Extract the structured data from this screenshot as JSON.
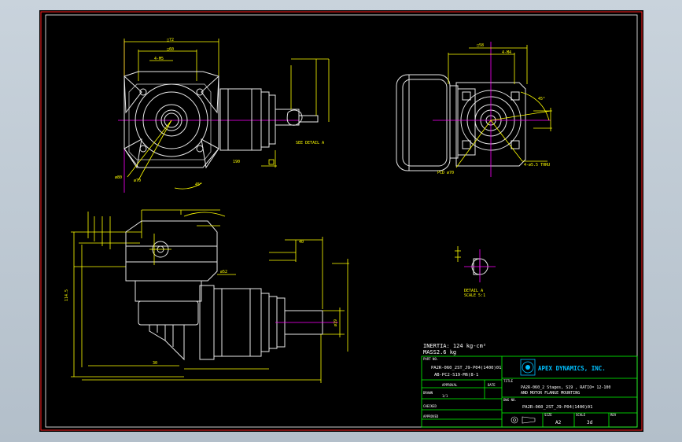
{
  "drawing": {
    "notes": {
      "inertia": "INERTIA: 124 kg-cm²",
      "mass": "MASS2.6 kg"
    },
    "title_block": {
      "part_no_label": "PART NO.",
      "part_no_line1": "PA2R-060_2ST_J9-P04(1400)01",
      "part_no_line2": "AB-PC2-S19-M6(8-1",
      "approval_label": "APPROVAL",
      "date_label": "DATE",
      "drawn_label": "DRAWN",
      "drawn_value": "1/1",
      "checked_label": "CHECKED",
      "approved_label": "APPROVED",
      "company": "APEX DYNAMICS, INC.",
      "title_label": "TITLE",
      "title_line1": "PA2R-060_2 Stages, S19 , RATIO= 12-100",
      "title_line2": "AND MOTOR FLANGE MOUNTING",
      "dwg_no_label": "DWG NO.",
      "dwg_no_value": "PA2R-060_2ST_J9-P04(1400)01",
      "size_label": "SIZE",
      "size_value": "A2",
      "scale_label": "SCALE",
      "scale_value": "3d",
      "rev_label": "REV"
    },
    "detail": {
      "label": "DETAIL A",
      "scale": "SCALE 5:1"
    },
    "see_detail": "SEE DETAIL A",
    "dimensions": {
      "front_top": "□72",
      "front_inner": "□60",
      "front_small": "4-M5",
      "front_dia1": "ø80",
      "front_dia2": "ø70",
      "front_angle": "45°",
      "side_height": "190",
      "side_overall": "114.5",
      "side_base": "30",
      "side_shaft": "ø19",
      "side_pcd": "ø52",
      "right_top": "□58",
      "right_screw": "4-M4",
      "right_pcd": "PCD ø70",
      "right_holes": "4-ø5.5 THRU",
      "right_angle": "45°",
      "shaft_len": "40",
      "key": "6",
      "b_ang": "31"
    }
  }
}
